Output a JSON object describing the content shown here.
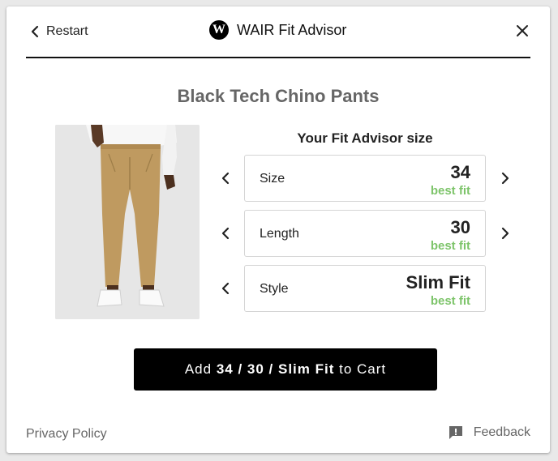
{
  "header": {
    "restart_label": "Restart",
    "logo_letter": "W",
    "title": "WAIR Fit Advisor"
  },
  "product": {
    "title": "Black Tech Chino Pants",
    "image_icon": "product-photo-chino-pants"
  },
  "advisor": {
    "title": "Your Fit Advisor size",
    "fit_color": "#7dc46a",
    "options": [
      {
        "label": "Size",
        "value": "34",
        "fit": "best fit"
      },
      {
        "label": "Length",
        "value": "30",
        "fit": "best fit"
      },
      {
        "label": "Style",
        "value": "Slim Fit",
        "fit": "best fit"
      }
    ]
  },
  "cart": {
    "prefix": "Add ",
    "size": "34",
    "sep1": " / ",
    "length": "30",
    "sep2": " / ",
    "style": "Slim Fit",
    "suffix": " to Cart",
    "bg_color": "#000000"
  },
  "footer": {
    "privacy_label": "Privacy Policy",
    "feedback_label": "Feedback"
  }
}
